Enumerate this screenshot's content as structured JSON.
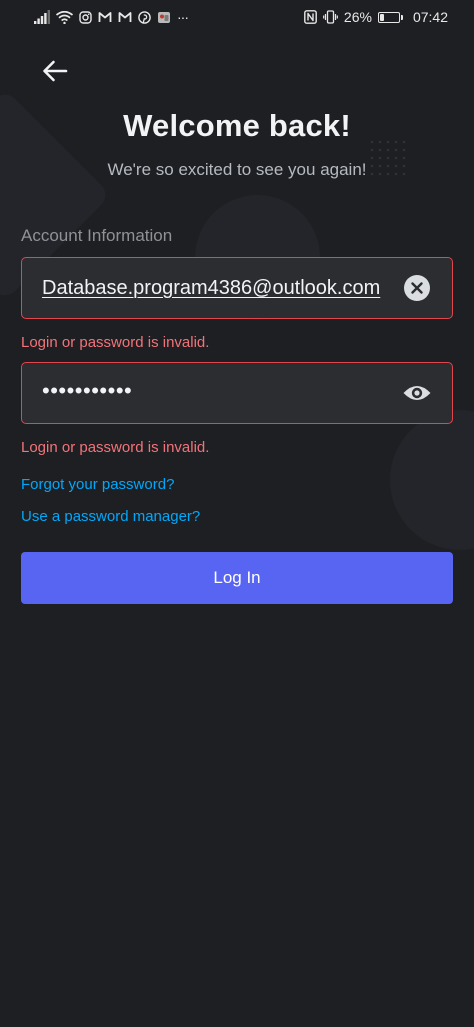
{
  "status_bar": {
    "battery_percent": "26%",
    "battery_level": 0.26,
    "time": "07:42",
    "left_icons": [
      "signal-icon",
      "wifi-icon",
      "instagram-icon",
      "gmail-icon",
      "gmail-icon",
      "pinterest-icon",
      "app-notification-icon",
      "more-icon"
    ],
    "right_icons": [
      "nfc-icon",
      "vibrate-icon",
      "battery-icon"
    ],
    "more_glyph": "···"
  },
  "header": {
    "back_icon": "arrow-left-icon",
    "title": "Welcome back!",
    "subtitle": "We're so excited to see you again!"
  },
  "form": {
    "section_label": "Account Information",
    "email": {
      "value": "Database.program4386@outlook.com",
      "clear_icon": "clear-icon"
    },
    "email_error": "Login or password is invalid.",
    "password": {
      "value": "•••••••••••",
      "toggle_icon": "eye-icon"
    },
    "password_error": "Login or password is invalid.",
    "forgot_password_link": "Forgot your password?",
    "password_manager_link": "Use a password manager?",
    "login_button": "Log In"
  },
  "colors": {
    "background": "#1e1f22",
    "field_background": "#2b2d31",
    "error": "#f2737a",
    "error_border": "#e0464c",
    "link": "#00a8fc",
    "primary_button": "#5865f2"
  }
}
